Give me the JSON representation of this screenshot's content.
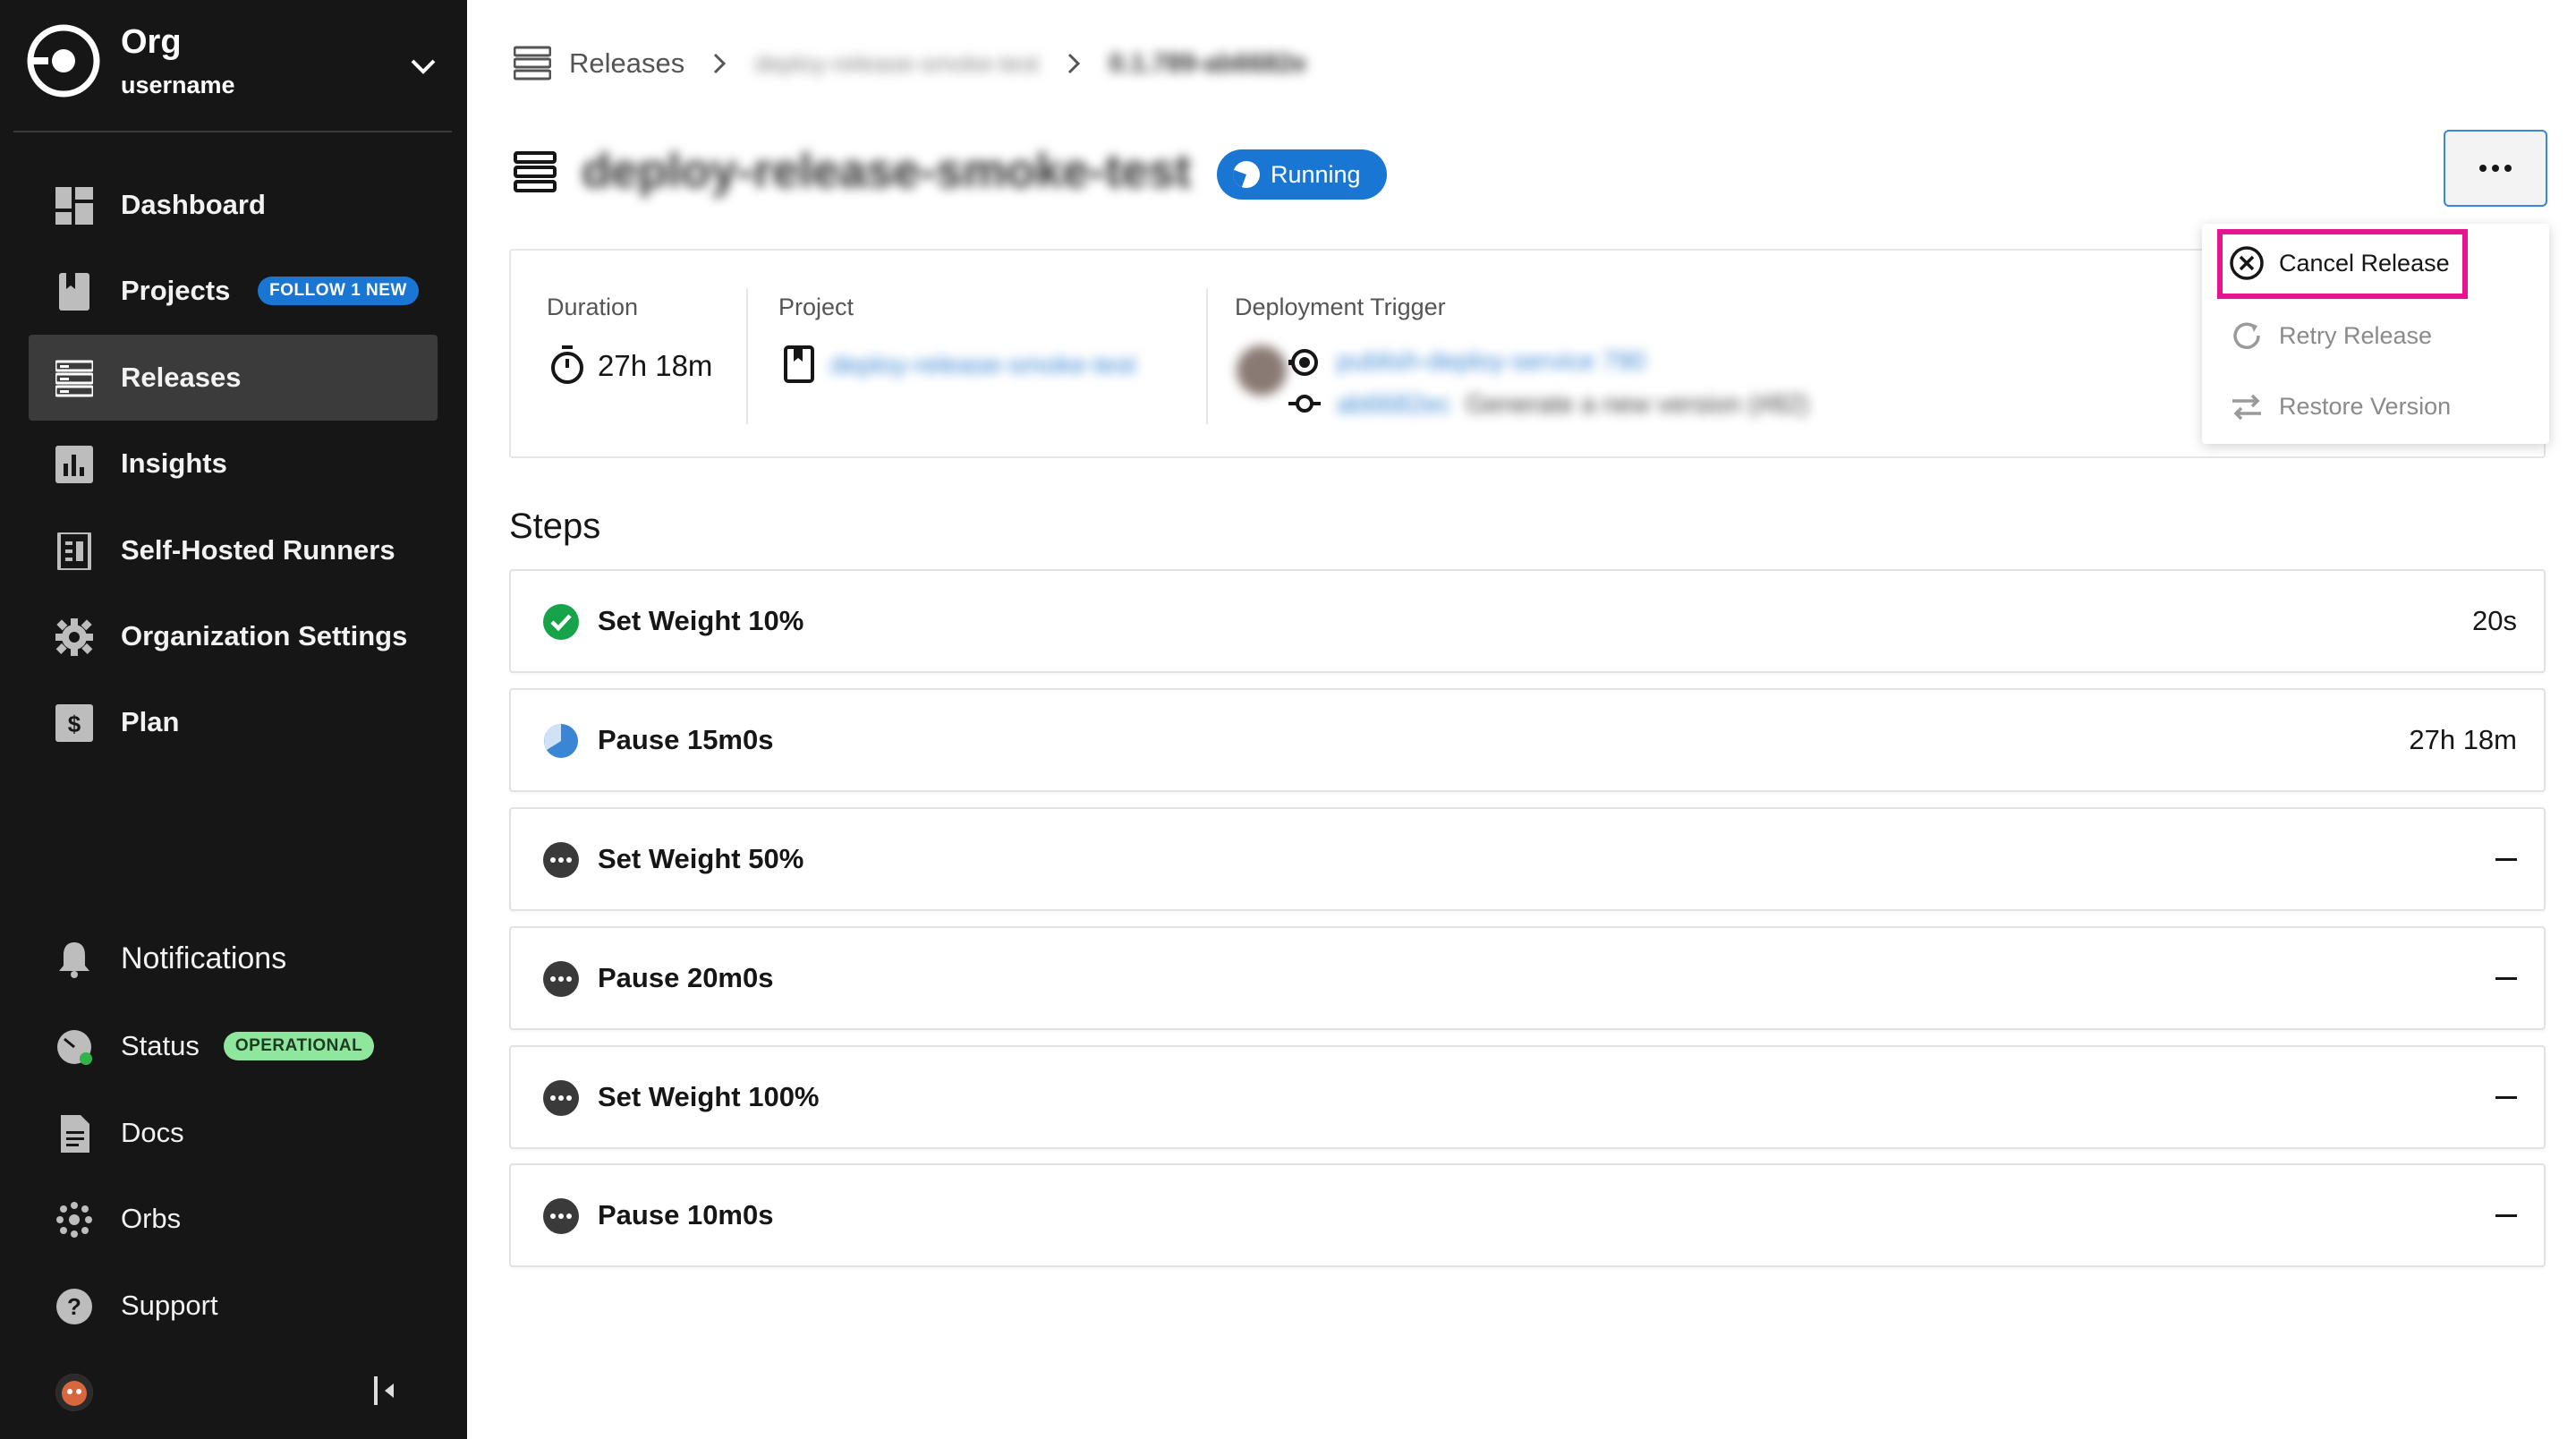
{
  "sidebar": {
    "org_name": "Org",
    "username": "username",
    "nav": [
      {
        "label": "Dashboard"
      },
      {
        "label": "Projects",
        "badge": "FOLLOW 1 NEW"
      },
      {
        "label": "Releases"
      },
      {
        "label": "Insights"
      },
      {
        "label": "Self-Hosted Runners"
      },
      {
        "label": "Organization Settings"
      },
      {
        "label": "Plan"
      }
    ],
    "bottom": [
      {
        "label": "Notifications"
      },
      {
        "label": "Status",
        "badge": "OPERATIONAL"
      },
      {
        "label": "Docs"
      },
      {
        "label": "Orbs"
      },
      {
        "label": "Support"
      }
    ],
    "colors": {
      "background": "#161616",
      "active": "#3b3b3b",
      "accent": "#1976d2",
      "operational": "#8ee79c"
    }
  },
  "breadcrumb": {
    "root": "Releases",
    "component": "deploy-release-smoke-test",
    "version": "0.1.789-ab6682e"
  },
  "release": {
    "title": "deploy-release-smoke-test",
    "status": "Running"
  },
  "info": {
    "duration_label": "Duration",
    "duration_value": "27h 18m",
    "project_label": "Project",
    "project_value": "deploy-release-smoke-test",
    "trigger_label": "Deployment Trigger",
    "trigger_workflow": "publish-deploy-service 790",
    "trigger_commit": "ab6682ec",
    "trigger_message": "Generate a new version (#82)"
  },
  "steps_heading": "Steps",
  "steps": [
    {
      "name": "Set Weight 10%",
      "time": "20s",
      "state": "success"
    },
    {
      "name": "Pause 15m0s",
      "time": "27h 18m",
      "state": "running"
    },
    {
      "name": "Set Weight 50%",
      "time": "",
      "state": "pending"
    },
    {
      "name": "Pause 20m0s",
      "time": "",
      "state": "pending"
    },
    {
      "name": "Set Weight 100%",
      "time": "",
      "state": "pending"
    },
    {
      "name": "Pause 10m0s",
      "time": "",
      "state": "pending"
    }
  ],
  "actions_menu": {
    "items": [
      {
        "label": "Cancel Release",
        "enabled": true,
        "icon": "cancel-circle-icon"
      },
      {
        "label": "Retry Release",
        "enabled": false,
        "icon": "refresh-icon"
      },
      {
        "label": "Restore Version",
        "enabled": false,
        "icon": "swap-arrows-icon"
      }
    ],
    "highlight_color": "#e8138f"
  }
}
